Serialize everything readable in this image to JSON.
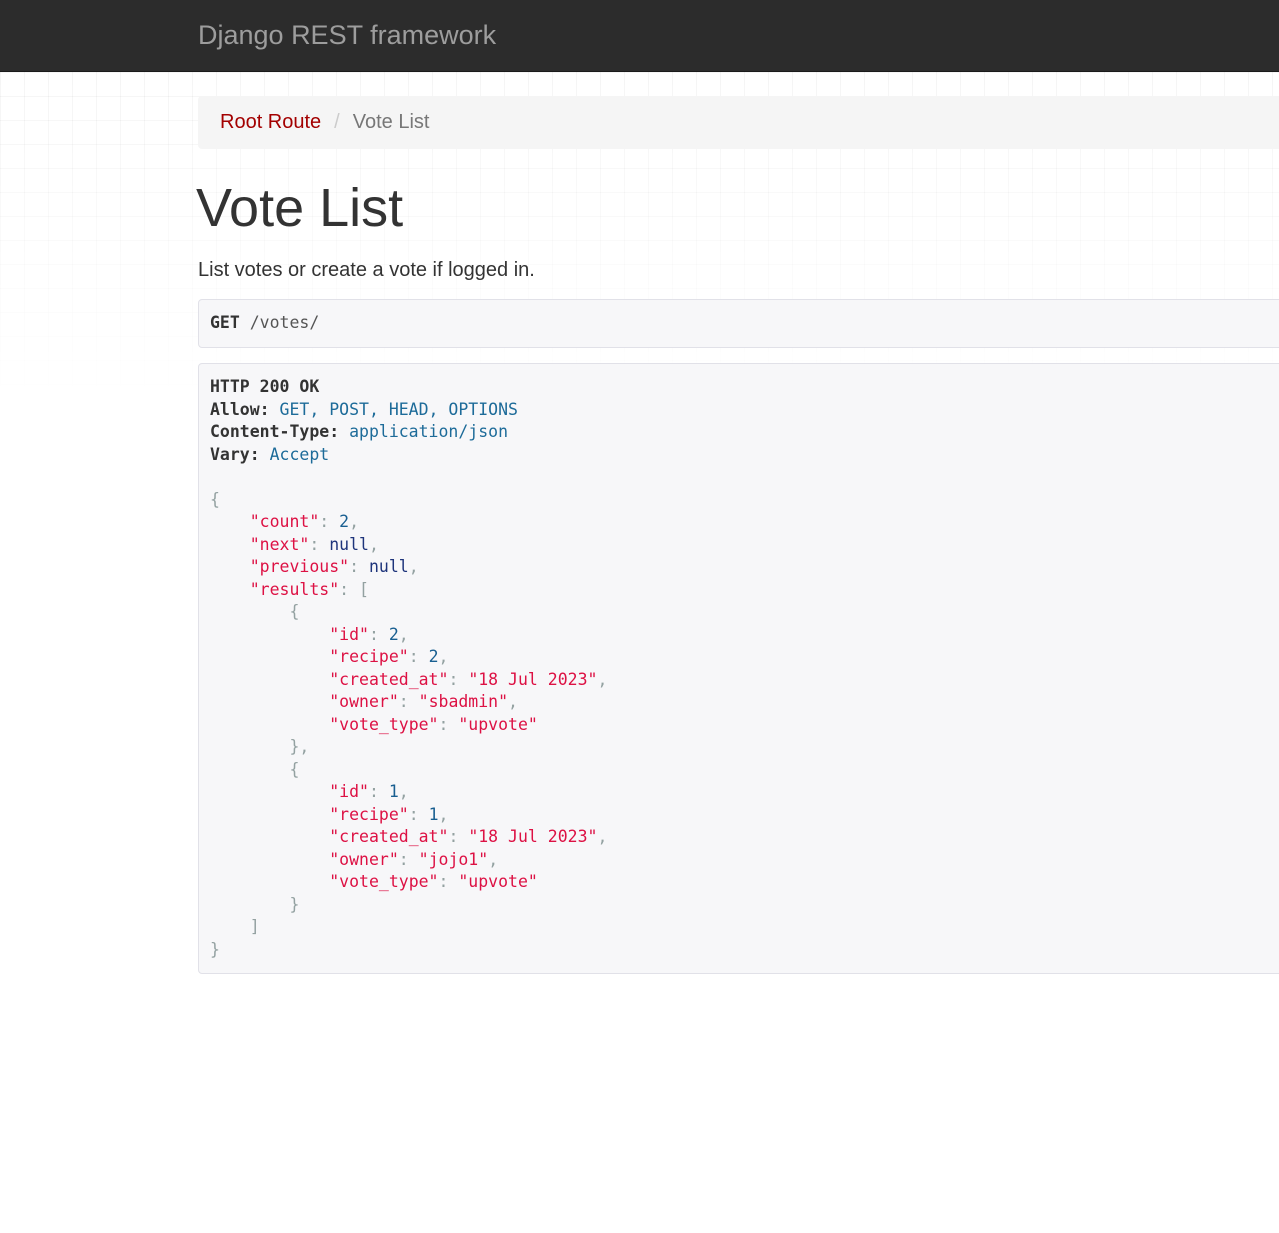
{
  "navbar": {
    "brand": "Django REST framework"
  },
  "breadcrumb": {
    "items": [
      {
        "label": "Root Route"
      },
      {
        "label": "Vote List"
      }
    ],
    "separator": "/"
  },
  "page": {
    "title": "Vote List",
    "description": "List votes or create a vote if logged in."
  },
  "request": {
    "method": "GET",
    "path": "/votes/"
  },
  "response": {
    "status_line": "HTTP 200 OK",
    "headers": [
      {
        "name": "Allow:",
        "value": "GET, POST, HEAD, OPTIONS"
      },
      {
        "name": "Content-Type:",
        "value": "application/json"
      },
      {
        "name": "Vary:",
        "value": "Accept"
      }
    ],
    "body": {
      "count_key": "\"count\"",
      "count": "2",
      "next_key": "\"next\"",
      "next": "null",
      "previous_key": "\"previous\"",
      "previous": "null",
      "results_key": "\"results\"",
      "results": [
        {
          "id": "2",
          "recipe": "2",
          "created_at": "\"18 Jul 2023\"",
          "owner": "\"sbadmin\"",
          "vote_type": "\"upvote\""
        },
        {
          "id": "1",
          "recipe": "1",
          "created_at": "\"18 Jul 2023\"",
          "owner": "\"jojo1\"",
          "vote_type": "\"upvote\""
        }
      ],
      "keys": {
        "id": "\"id\"",
        "recipe": "\"recipe\"",
        "created_at": "\"created_at\"",
        "owner": "\"owner\"",
        "vote_type": "\"vote_type\""
      }
    }
  },
  "colors": {
    "navbar_bg": "#2c2c2c",
    "brand_text": "#9d9d9d",
    "breadcrumb_link": "#a30000",
    "json_string": "#dd1144",
    "json_number": "#195f91",
    "json_null": "#1e347b",
    "header_value": "#1d6b99"
  }
}
